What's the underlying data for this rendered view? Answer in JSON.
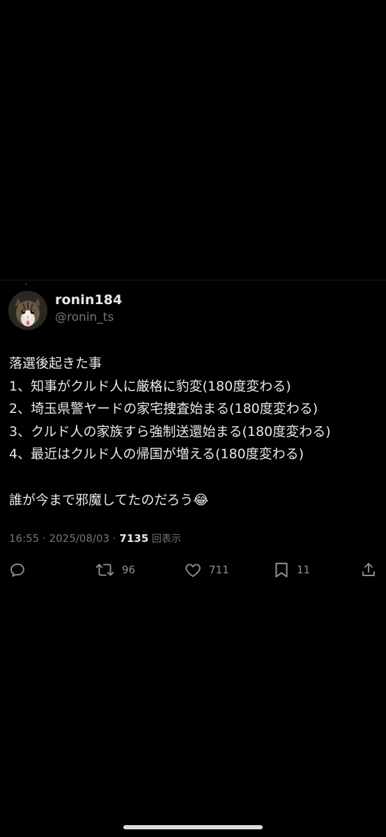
{
  "user": {
    "display_name": "ronin184",
    "handle": "@ronin_ts"
  },
  "tweet": {
    "lines": [
      "落選後起きた事",
      "1、知事がクルド人に厳格に豹変(180度変わる)",
      "2、埼玉県警ヤードの家宅捜査始まる(180度変わる)",
      "3、クルド人の家族すら強制送還始まる(180度変わる)",
      "4、最近はクルド人の帰国が増える(180度変わる)",
      "",
      "誰が今まで邪魔してたのだろう😂"
    ]
  },
  "meta": {
    "time": "16:55",
    "separator": "·",
    "date": "2025/08/03",
    "views_count": "7135",
    "views_label": "回表示"
  },
  "actions": {
    "reply": {
      "icon": "reply-icon"
    },
    "retweet": {
      "icon": "retweet-icon",
      "count": "96"
    },
    "like": {
      "icon": "heart-icon",
      "count": "711"
    },
    "bookmark": {
      "icon": "bookmark-icon",
      "count": "11"
    },
    "share": {
      "icon": "share-icon"
    }
  },
  "colors": {
    "background": "#000000",
    "text_primary": "#e7e9ea",
    "text_secondary": "#71767b"
  }
}
